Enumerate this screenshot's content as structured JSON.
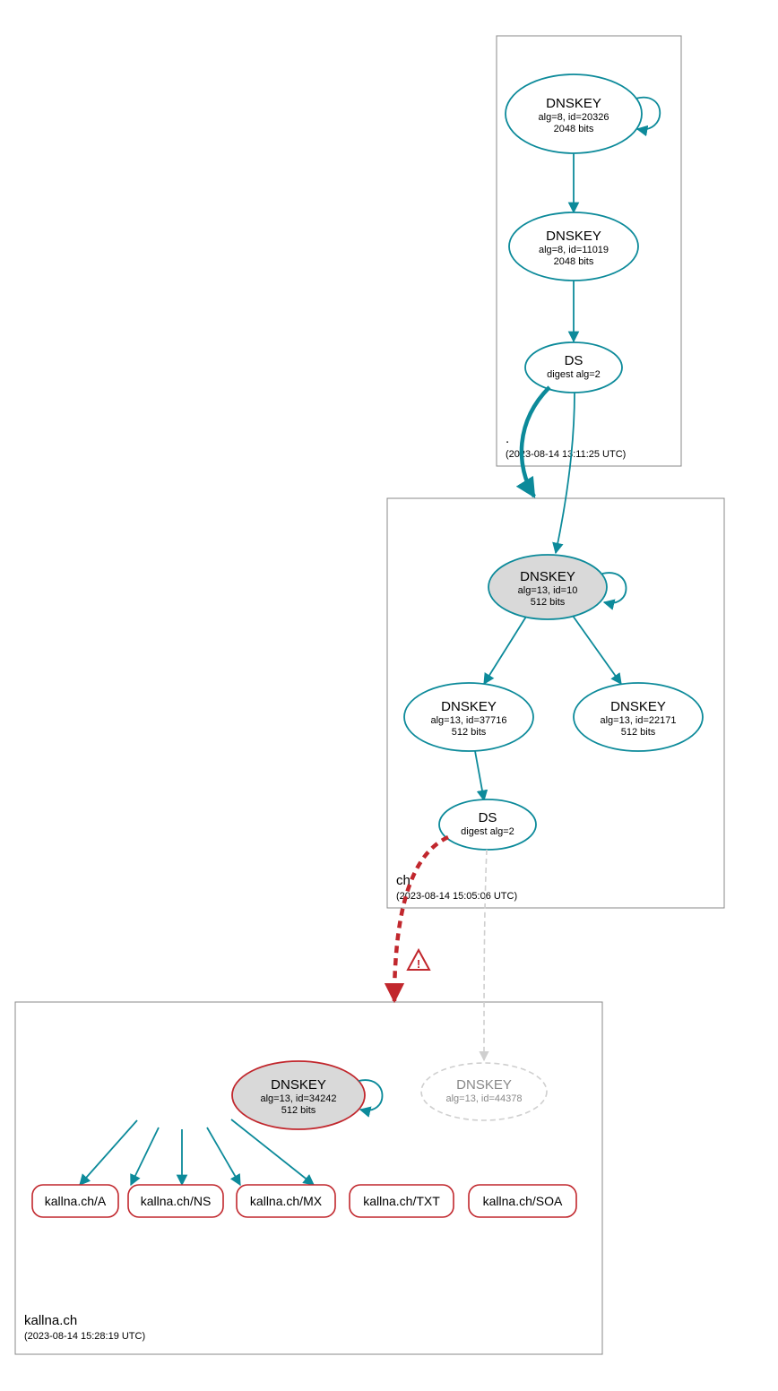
{
  "zones": {
    "root": {
      "label": ".",
      "timestamp": "(2023-08-14 13:11:25 UTC)"
    },
    "ch": {
      "label": "ch",
      "timestamp": "(2023-08-14 15:05:06 UTC)"
    },
    "kallna": {
      "label": "kallna.ch",
      "timestamp": "(2023-08-14 15:28:19 UTC)"
    }
  },
  "nodes": {
    "root_ksk": {
      "title": "DNSKEY",
      "line1": "alg=8, id=20326",
      "line2": "2048 bits"
    },
    "root_zsk": {
      "title": "DNSKEY",
      "line1": "alg=8, id=11019",
      "line2": "2048 bits"
    },
    "root_ds": {
      "title": "DS",
      "line1": "digest alg=2"
    },
    "ch_ksk": {
      "title": "DNSKEY",
      "line1": "alg=13, id=10",
      "line2": "512 bits"
    },
    "ch_zsk1": {
      "title": "DNSKEY",
      "line1": "alg=13, id=37716",
      "line2": "512 bits"
    },
    "ch_zsk2": {
      "title": "DNSKEY",
      "line1": "alg=13, id=22171",
      "line2": "512 bits"
    },
    "ch_ds": {
      "title": "DS",
      "line1": "digest alg=2"
    },
    "kallna_key": {
      "title": "DNSKEY",
      "line1": "alg=13, id=34242",
      "line2": "512 bits"
    },
    "kallna_ghost": {
      "title": "DNSKEY",
      "line1": "alg=13, id=44378"
    }
  },
  "rrsets": {
    "a": "kallna.ch/A",
    "ns": "kallna.ch/NS",
    "mx": "kallna.ch/MX",
    "txt": "kallna.ch/TXT",
    "soa": "kallna.ch/SOA"
  },
  "chart_data": {
    "type": "dnssec-delegation-graph",
    "zones": [
      {
        "name": ".",
        "observed": "2023-08-14 13:11:25 UTC"
      },
      {
        "name": "ch",
        "observed": "2023-08-14 15:05:06 UTC"
      },
      {
        "name": "kallna.ch",
        "observed": "2023-08-14 15:28:19 UTC"
      }
    ],
    "keys": [
      {
        "id": "root_ksk",
        "zone": ".",
        "type": "DNSKEY",
        "alg": 8,
        "key_id": 20326,
        "bits": 2048,
        "role": "KSK",
        "trust_anchor": true
      },
      {
        "id": "root_zsk",
        "zone": ".",
        "type": "DNSKEY",
        "alg": 8,
        "key_id": 11019,
        "bits": 2048,
        "role": "ZSK"
      },
      {
        "id": "root_ds",
        "zone": ".",
        "type": "DS",
        "digest_alg": 2
      },
      {
        "id": "ch_ksk",
        "zone": "ch",
        "type": "DNSKEY",
        "alg": 13,
        "key_id": 10,
        "bits": 512,
        "role": "KSK"
      },
      {
        "id": "ch_zsk1",
        "zone": "ch",
        "type": "DNSKEY",
        "alg": 13,
        "key_id": 37716,
        "bits": 512,
        "role": "ZSK"
      },
      {
        "id": "ch_zsk2",
        "zone": "ch",
        "type": "DNSKEY",
        "alg": 13,
        "key_id": 22171,
        "bits": 512,
        "role": "ZSK"
      },
      {
        "id": "ch_ds",
        "zone": "ch",
        "type": "DS",
        "digest_alg": 2
      },
      {
        "id": "kallna_key",
        "zone": "kallna.ch",
        "type": "DNSKEY",
        "alg": 13,
        "key_id": 34242,
        "bits": 512,
        "status": "warning"
      },
      {
        "id": "kallna_ghost",
        "zone": "kallna.ch",
        "type": "DNSKEY",
        "alg": 13,
        "key_id": 44378,
        "status": "missing"
      }
    ],
    "edges": [
      {
        "from": "root_ksk",
        "to": "root_ksk",
        "kind": "self-sig"
      },
      {
        "from": "root_ksk",
        "to": "root_zsk",
        "kind": "sig"
      },
      {
        "from": "root_zsk",
        "to": "root_ds",
        "kind": "sig"
      },
      {
        "from": "root_ds",
        "to": "ch_ksk",
        "kind": "delegation-secure"
      },
      {
        "from": "ch_ksk",
        "to": "ch_ksk",
        "kind": "self-sig"
      },
      {
        "from": "ch_ksk",
        "to": "ch_zsk1",
        "kind": "sig"
      },
      {
        "from": "ch_ksk",
        "to": "ch_zsk2",
        "kind": "sig"
      },
      {
        "from": "ch_zsk1",
        "to": "ch_ds",
        "kind": "sig"
      },
      {
        "from": "ch_ds",
        "to": "kallna_key",
        "kind": "delegation-warning"
      },
      {
        "from": "ch_ds",
        "to": "kallna_ghost",
        "kind": "delegation-missing"
      },
      {
        "from": "kallna_key",
        "to": "kallna_key",
        "kind": "self-sig"
      },
      {
        "from": "kallna_key",
        "to": "kallna.ch/A",
        "kind": "sig"
      },
      {
        "from": "kallna_key",
        "to": "kallna.ch/NS",
        "kind": "sig"
      },
      {
        "from": "kallna_key",
        "to": "kallna.ch/MX",
        "kind": "sig"
      },
      {
        "from": "kallna_key",
        "to": "kallna.ch/TXT",
        "kind": "sig"
      },
      {
        "from": "kallna_key",
        "to": "kallna.ch/SOA",
        "kind": "sig"
      }
    ],
    "signed_rrsets": [
      "kallna.ch/A",
      "kallna.ch/NS",
      "kallna.ch/MX",
      "kallna.ch/TXT",
      "kallna.ch/SOA"
    ]
  }
}
